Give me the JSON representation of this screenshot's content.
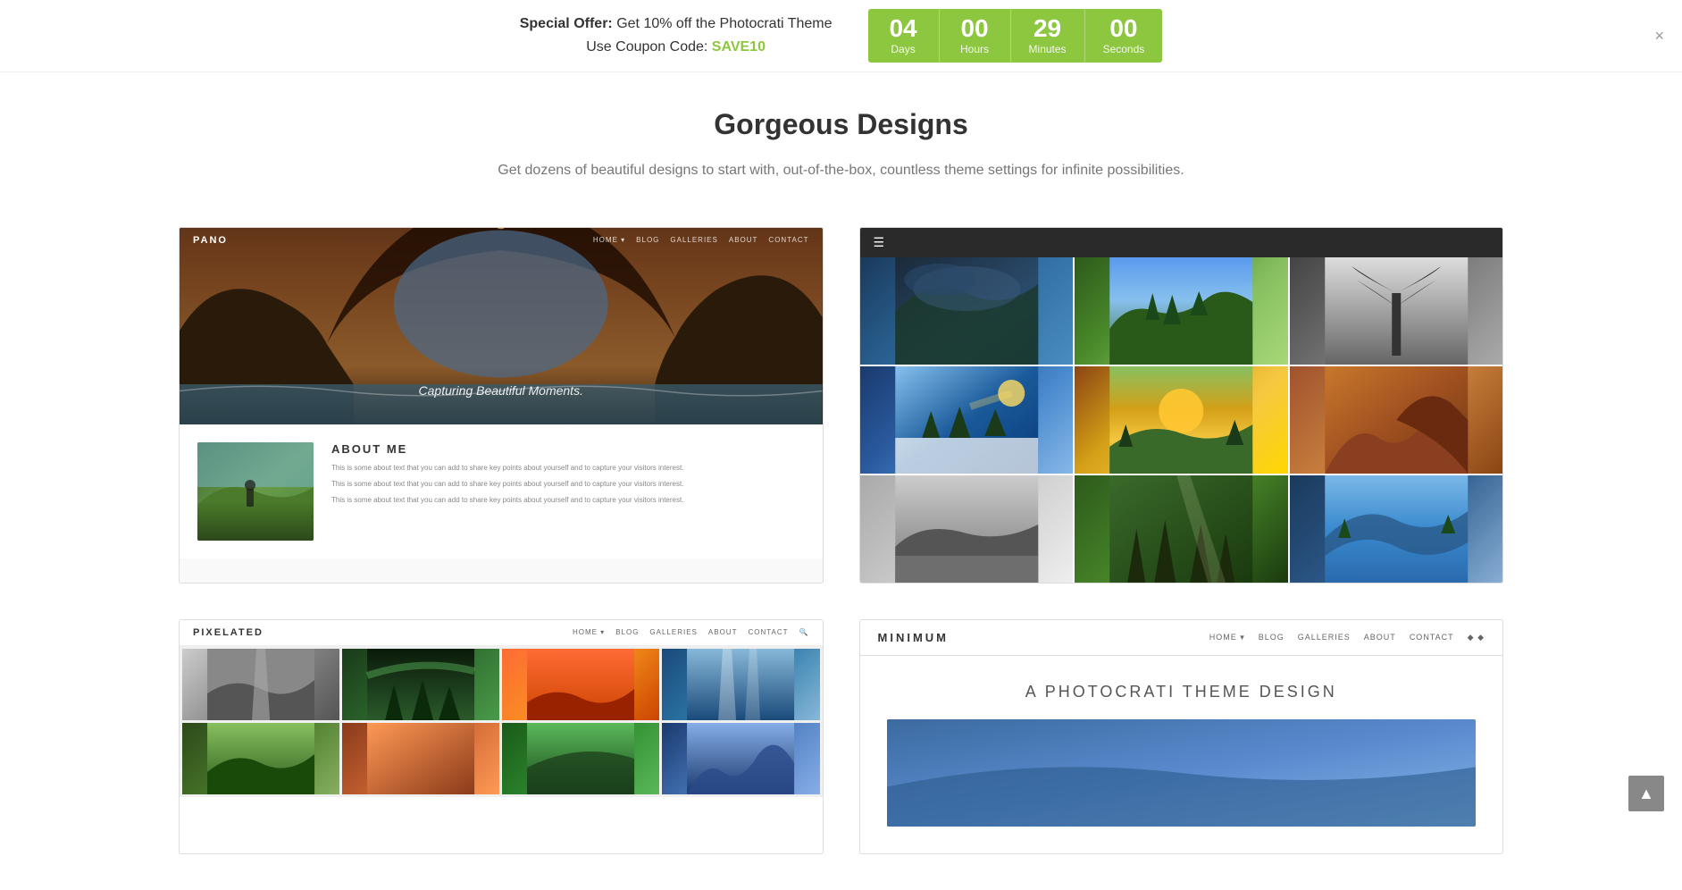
{
  "banner": {
    "offer_label": "Special Offer:",
    "offer_text": " Get 10% off the Photocrati Theme",
    "coupon_label": "Use Coupon Code:",
    "coupon_code": "SAVE10",
    "close_label": "×"
  },
  "countdown": {
    "days_number": "04",
    "days_label": "Days",
    "hours_number": "00",
    "hours_label": "Hours",
    "minutes_number": "29",
    "minutes_label": "Minutes",
    "seconds_number": "00",
    "seconds_label": "Seconds"
  },
  "section": {
    "title": "Gorgeous Designs",
    "subtitle": "Get dozens of beautiful designs to start with, out-of-the-box, countless theme settings for infinite possibilities."
  },
  "cards": [
    {
      "id": "pano",
      "logo": "PANO",
      "nav": [
        "HOME ▾",
        "BLOG",
        "GALLERIES",
        "ABOUT",
        "CONTACT"
      ],
      "tagline": "Capturing Beautiful Moments.",
      "about_title": "ABOUT ME",
      "about_paras": [
        "This is some about text that you can add to share key points about yourself and to capture your visitors interest.",
        "This is some about text that you can add to share key points about yourself and to capture your visitors interest.",
        "This is some about text that you can add to share key points about yourself and to capture your visitors interest."
      ]
    },
    {
      "id": "photo-grid",
      "menu_icon": "☰"
    },
    {
      "id": "pixelated",
      "logo": "PIXELATED",
      "nav": [
        "HOME ▾",
        "BLOG",
        "GALLERIES",
        "ABOUT",
        "CONTACT",
        "🔍"
      ]
    },
    {
      "id": "minimum",
      "logo": "MINIMUM",
      "nav": [
        "HOME ▾",
        "BLOG",
        "GALLERIES",
        "ABOUT",
        "CONTACT",
        "♦ ♦"
      ],
      "tagline": "A PHOTOCRATI THEME DESIGN"
    }
  ],
  "scroll_btn": "▲"
}
